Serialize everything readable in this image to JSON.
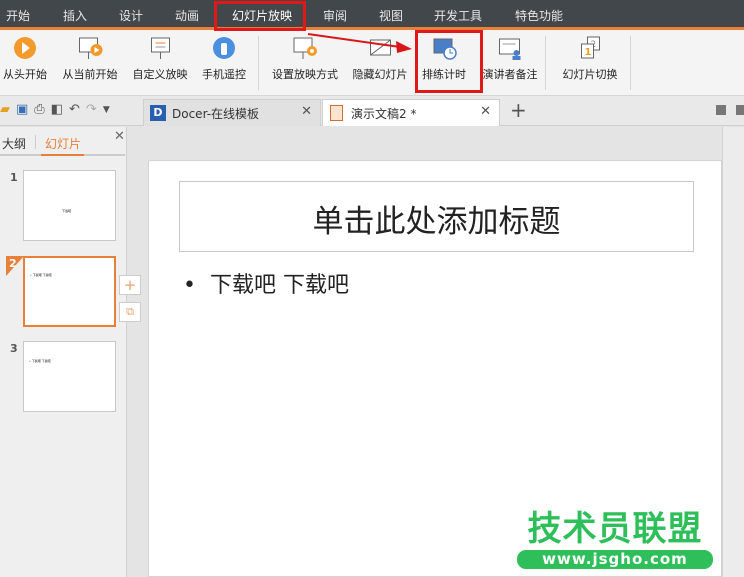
{
  "menubar": {
    "items": [
      "开始",
      "插入",
      "设计",
      "动画",
      "幻灯片放映",
      "审阅",
      "视图",
      "开发工具",
      "特色功能"
    ],
    "active": "幻灯片放映"
  },
  "ribbon": {
    "buttons": [
      {
        "label": "从头开始",
        "icon": "play-circle-icon"
      },
      {
        "label": "从当前开始",
        "icon": "play-from-current-icon"
      },
      {
        "label": "自定义放映",
        "icon": "custom-show-icon"
      },
      {
        "label": "手机遥控",
        "icon": "phone-remote-icon"
      },
      {
        "label": "设置放映方式",
        "icon": "setup-show-icon"
      },
      {
        "label": "隐藏幻灯片",
        "icon": "hide-slide-icon"
      },
      {
        "label": "排练计时",
        "icon": "rehearse-timing-icon"
      },
      {
        "label": "演讲者备注",
        "icon": "speaker-notes-icon"
      },
      {
        "label": "幻灯片切换",
        "icon": "slide-transition-icon"
      }
    ]
  },
  "tabs": [
    {
      "label": "Docer-在线模板"
    },
    {
      "label": "演示文稿2 *",
      "active": true
    }
  ],
  "leftpane": {
    "tabs": [
      "大纲",
      "幻灯片"
    ],
    "active": "幻灯片",
    "slides": [
      {
        "num": "1",
        "text": "下载吧"
      },
      {
        "num": "2",
        "text": "• 下载吧 下载吧"
      },
      {
        "num": "3",
        "text": "• 下载吧 下载吧"
      }
    ],
    "selected": "2"
  },
  "slide": {
    "title_placeholder": "单击此处添加标题",
    "bullet": "下载吧  下载吧"
  },
  "watermark": {
    "text": "技术员联盟",
    "url": "www.jsgho.com"
  },
  "colors": {
    "accent": "#e8803a",
    "menubar": "#42474c",
    "highlight": "#e01818",
    "watermark": "#2fbf5a"
  }
}
